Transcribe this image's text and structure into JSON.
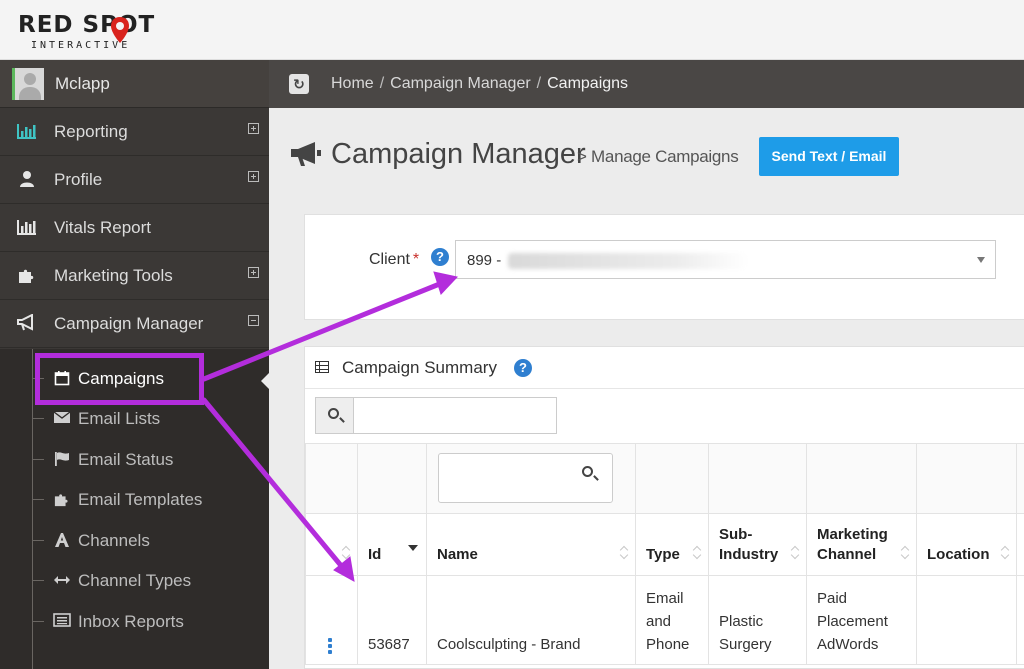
{
  "logo": {
    "main": "RED SPOT",
    "sub": "INTERACTIVE"
  },
  "sidebar": {
    "user_name": "Mclapp",
    "items": [
      {
        "label": "Reporting",
        "icon": "bar-chart-icon",
        "expander": "plus"
      },
      {
        "label": "Profile",
        "icon": "user-icon",
        "expander": "plus"
      },
      {
        "label": "Vitals Report",
        "icon": "bar-chart-icon",
        "expander": "none"
      },
      {
        "label": "Marketing Tools",
        "icon": "puzzle-icon",
        "expander": "plus"
      },
      {
        "label": "Campaign Manager",
        "icon": "megaphone-icon",
        "expander": "minus"
      }
    ],
    "subitems": [
      {
        "label": "Campaigns",
        "icon": "calendar-icon",
        "active": true
      },
      {
        "label": "Email Lists",
        "icon": "envelope-icon"
      },
      {
        "label": "Email Status",
        "icon": "flag-icon"
      },
      {
        "label": "Email Templates",
        "icon": "puzzle-icon"
      },
      {
        "label": "Channels",
        "icon": "font-icon"
      },
      {
        "label": "Channel Types",
        "icon": "arrows-h-icon"
      },
      {
        "label": "Inbox Reports",
        "icon": "list-icon"
      }
    ]
  },
  "breadcrumb": {
    "items": [
      "Home",
      "Campaign Manager",
      "Campaigns"
    ]
  },
  "page": {
    "title": "Campaign Manager",
    "subtitle": "> Manage Campaigns",
    "send_button": "Send Text / Email"
  },
  "client": {
    "label": "Client",
    "required_mark": "*",
    "help": "?",
    "value": "899 -"
  },
  "summary": {
    "title": "Campaign Summary",
    "help": "?",
    "search_placeholder": "",
    "columns": [
      "Id",
      "Name",
      "Type",
      "Sub-Industry",
      "Marketing Channel",
      "Location"
    ],
    "rows": [
      {
        "id": "53687",
        "name": "Coolsculpting - Brand",
        "type": "Email and Phone",
        "sub_industry": "Plastic Surgery",
        "channel": "Paid Placement AdWords",
        "location": ""
      }
    ]
  },
  "colors": {
    "accent": "#1e9ce8",
    "annotation": "#b32ddc",
    "sidebar": "#3b3836"
  }
}
